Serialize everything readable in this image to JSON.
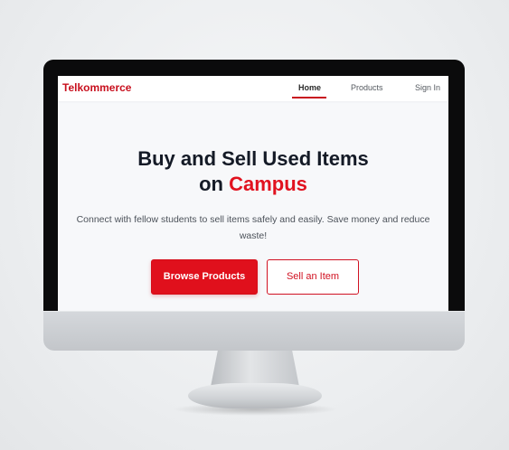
{
  "brand": {
    "name": "Telkommerce",
    "accent_color": "#e0101c"
  },
  "nav": {
    "items": [
      {
        "label": "Home",
        "active": true
      },
      {
        "label": "Products",
        "active": false
      },
      {
        "label": "Sign In",
        "active": false
      }
    ]
  },
  "hero": {
    "title_line1": "Buy and Sell Used Items",
    "title_line2_prefix": "on",
    "title_line2_accent": "Campus",
    "subtitle": "Connect with fellow students to sell items safely and easily. Save money and reduce waste!",
    "primary_button": "Browse Products",
    "secondary_button": "Sell an Item"
  }
}
